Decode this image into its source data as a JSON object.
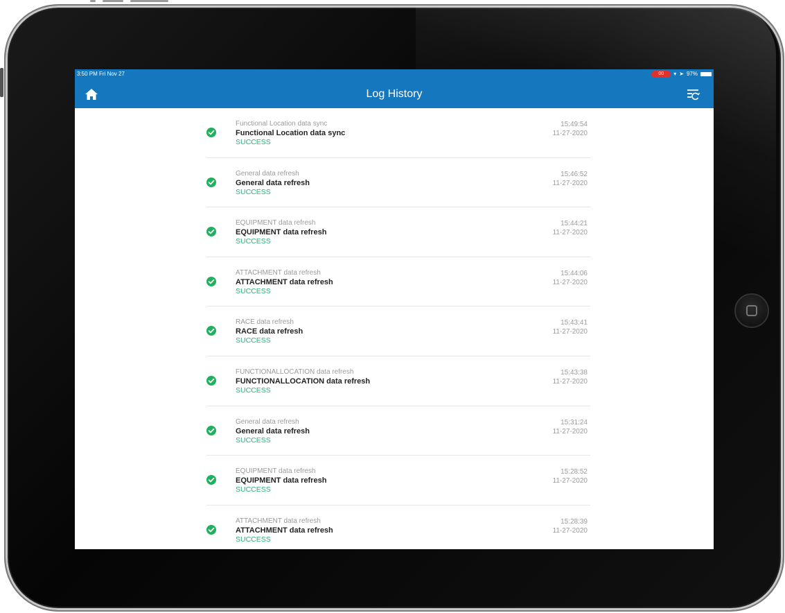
{
  "statusbar": {
    "time": "3:50 PM  Fri Nov 27",
    "record_indicator": "00",
    "battery": "97%"
  },
  "header": {
    "title": "Log History",
    "left_icon": "home-icon",
    "right_icon": "sync-filter-icon"
  },
  "colors": {
    "accent": "#1578be",
    "success": "#1fb15e"
  },
  "logs": [
    {
      "subtitle": "Functional Location data sync",
      "title": "Functional Location data sync",
      "status": "SUCCESS",
      "time": "15:49:54",
      "date": "11-27-2020"
    },
    {
      "subtitle": "General data refresh",
      "title": "General data refresh",
      "status": "SUCCESS",
      "time": "15:46:52",
      "date": "11-27-2020"
    },
    {
      "subtitle": "EQUIPMENT data refresh",
      "title": "EQUIPMENT data refresh",
      "status": "SUCCESS",
      "time": "15:44:21",
      "date": "11-27-2020"
    },
    {
      "subtitle": "ATTACHMENT data refresh",
      "title": "ATTACHMENT data refresh",
      "status": "SUCCESS",
      "time": "15:44:06",
      "date": "11-27-2020"
    },
    {
      "subtitle": "RACE data refresh",
      "title": "RACE data refresh",
      "status": "SUCCESS",
      "time": "15:43:41",
      "date": "11-27-2020"
    },
    {
      "subtitle": "FUNCTIONALLOCATION data refresh",
      "title": "FUNCTIONALLOCATION data refresh",
      "status": "SUCCESS",
      "time": "15:43:38",
      "date": "11-27-2020"
    },
    {
      "subtitle": "General data refresh",
      "title": "General data refresh",
      "status": "SUCCESS",
      "time": "15:31:24",
      "date": "11-27-2020"
    },
    {
      "subtitle": "EQUIPMENT data refresh",
      "title": "EQUIPMENT data refresh",
      "status": "SUCCESS",
      "time": "15:28:52",
      "date": "11-27-2020"
    },
    {
      "subtitle": "ATTACHMENT data refresh",
      "title": "ATTACHMENT data refresh",
      "status": "SUCCESS",
      "time": "15:28:39",
      "date": "11-27-2020"
    }
  ]
}
